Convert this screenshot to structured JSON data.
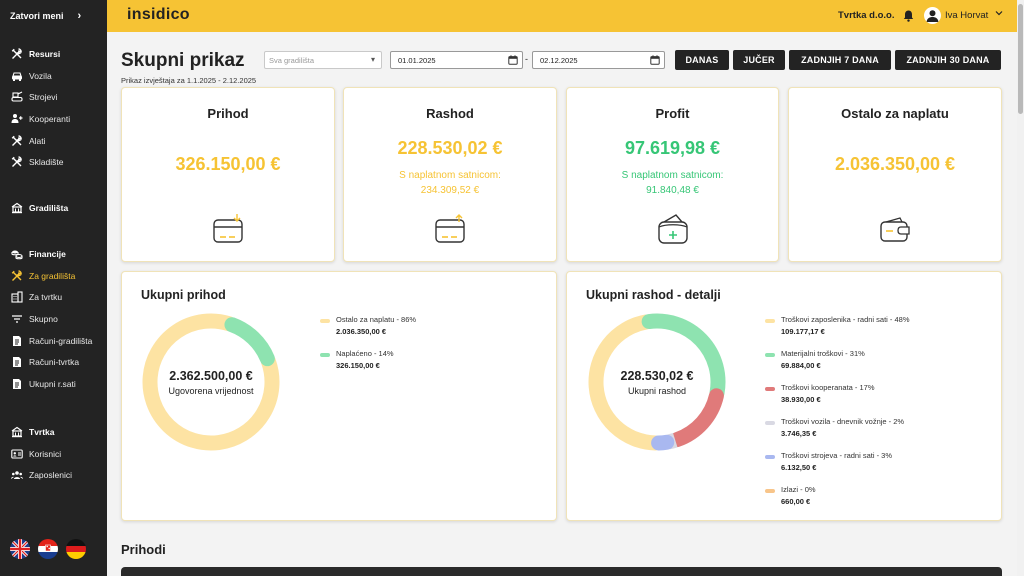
{
  "sidebar": {
    "toggle_label": "Zatvori meni",
    "groups": [
      {
        "items": [
          {
            "label": "Resursi",
            "icon": "tools-icon",
            "head": true
          },
          {
            "label": "Vozila",
            "icon": "car-icon"
          },
          {
            "label": "Strojevi",
            "icon": "machine-icon"
          },
          {
            "label": "Kooperanti",
            "icon": "handshake-icon"
          },
          {
            "label": "Alati",
            "icon": "tools-icon"
          },
          {
            "label": "Skladište",
            "icon": "tools-icon"
          }
        ]
      },
      {
        "items": [
          {
            "label": "Gradilišta",
            "icon": "building-icon",
            "head": true
          }
        ]
      },
      {
        "items": [
          {
            "label": "Financije",
            "icon": "coins-icon",
            "head": true
          },
          {
            "label": "Za gradilišta",
            "icon": "tools-icon",
            "active": true
          },
          {
            "label": "Za tvrtku",
            "icon": "office-icon"
          },
          {
            "label": "Skupno",
            "icon": "filter-icon"
          },
          {
            "label": "Računi-gradilišta",
            "icon": "invoice-icon"
          },
          {
            "label": "Računi-tvrtka",
            "icon": "invoice-icon"
          },
          {
            "label": "Ukupni r.sati",
            "icon": "invoice-icon"
          }
        ]
      },
      {
        "items": [
          {
            "label": "Tvrtka",
            "icon": "building-icon",
            "head": true
          },
          {
            "label": "Korisnici",
            "icon": "id-card-icon"
          },
          {
            "label": "Zaposlenici",
            "icon": "users-icon"
          }
        ]
      }
    ],
    "languages": [
      "uk-flag-icon",
      "croatia-flag-icon",
      "germany-flag-icon"
    ]
  },
  "header": {
    "logo": "insidico",
    "company": "Tvrtka d.o.o.",
    "user": "Iva Horvat"
  },
  "page": {
    "title": "Skupni prikaz",
    "report_range": "Prikaz izvještaja za 1.1.2025 - 2.12.2025",
    "site_placeholder": "Sva gradilišta",
    "date_from": "01.01.2025",
    "date_to": "02.12.2025",
    "date_separator": "-",
    "buttons": {
      "today": "DANAS",
      "yesterday": "JUČER",
      "last7": "ZADNJIH 7 DANA",
      "last30": "ZADNJIH 30 DANA"
    }
  },
  "stats": [
    {
      "title": "Prihod",
      "value": "326.150,00 €",
      "icon": "wallet-in-icon",
      "color": "#f6c334"
    },
    {
      "title": "Rashod",
      "value": "228.530,02 €",
      "sub1": "S naplatnom satnicom:",
      "sub2": "234.309,52 €",
      "icon": "wallet-out-icon",
      "color": "#f6c334"
    },
    {
      "title": "Profit",
      "value": "97.619,98 €",
      "sub1": "S naplatnom satnicom:",
      "sub2": "91.840,48 €",
      "icon": "wallet-plus-icon",
      "color": "#36c676"
    },
    {
      "title": "Ostalo za naplatu",
      "value": "2.036.350,00 €",
      "icon": "wallet-icon",
      "color": "#f6c334"
    }
  ],
  "income_chart": {
    "title": "Ukupni prihod",
    "center_value": "2.362.500,00 €",
    "center_label": "Ugovorena vrijednost",
    "legend": [
      {
        "label": "Ostalo za naplatu - 86%",
        "value": "2.036.350,00 €",
        "color": "#fde3a3"
      },
      {
        "label": "Naplaćeno - 14%",
        "value": "326.150,00 €",
        "color": "#8ee3b0"
      }
    ]
  },
  "expense_chart": {
    "title": "Ukupni rashod - detalji",
    "center_value": "228.530,02 €",
    "center_label": "Ukupni rashod",
    "legend": [
      {
        "label": "Troškovi zaposlenika - radni sati - 48%",
        "value": "109.177,17 €",
        "color": "#fde3a3"
      },
      {
        "label": "Materijalni troškovi - 31%",
        "value": "69.884,00 €",
        "color": "#8ee3b0"
      },
      {
        "label": "Troškovi kooperanata - 17%",
        "value": "38.930,00 €",
        "color": "#e07a7a"
      },
      {
        "label": "Troškovi vozila - dnevnik vožnje - 2%",
        "value": "3.746,35 €",
        "color": "#d9d9e3"
      },
      {
        "label": "Troškovi strojeva - radni sati - 3%",
        "value": "6.132,50 €",
        "color": "#a9b8f0"
      },
      {
        "label": "Izlazi - 0%",
        "value": "660,00 €",
        "color": "#f8c58a"
      }
    ]
  },
  "chart_data": [
    {
      "type": "pie",
      "title": "Ukupni prihod",
      "categories": [
        "Ostalo za naplatu",
        "Naplaćeno"
      ],
      "values": [
        86,
        14
      ]
    },
    {
      "type": "pie",
      "title": "Ukupni rashod - detalji",
      "categories": [
        "Troškovi zaposlenika - radni sati",
        "Materijalni troškovi",
        "Troškovi kooperanata",
        "Troškovi vozila - dnevnik vožnje",
        "Troškovi strojeva - radni sati",
        "Izlazi"
      ],
      "values": [
        48,
        31,
        17,
        2,
        3,
        0
      ]
    }
  ],
  "section": {
    "title": "Prihodi"
  }
}
